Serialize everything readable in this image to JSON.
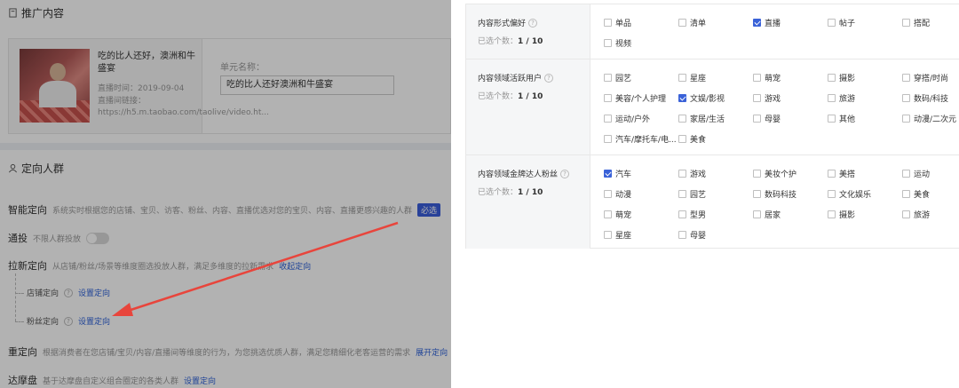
{
  "left": {
    "promo_title": "推广内容",
    "video": {
      "title": "吃的比人还好，澳洲和牛盛宴",
      "time": "直播时间：2019-09-04",
      "link": "直播间链接：https://h5.m.taobao.com/taolive/video.ht..."
    },
    "unit_label": "单元名称：",
    "unit_value": "吃的比人还好澳洲和牛盛宴",
    "target_title": "定向人群",
    "smart": {
      "name": "智能定向",
      "desc": "系统实时根据您的店铺、宝贝、访客、粉丝、内容、直播优选对您的宝贝、内容、直播更感兴趣的人群",
      "badge": "必选"
    },
    "tongtou": {
      "name": "通投",
      "desc": "不限人群投放"
    },
    "lax": {
      "name": "拉新定向",
      "desc": "从店铺/粉丝/场景等维度圈选投放人群，满足多维度的拉新需求",
      "link": "收起定向"
    },
    "shop": {
      "name": "店铺定向",
      "link": "设置定向"
    },
    "fans": {
      "name": "粉丝定向",
      "link": "设置定向"
    },
    "re": {
      "name": "重定向",
      "desc": "根据消费者在您店铺/宝贝/内容/直播间等维度的行为，为您挑选优质人群，满足您精细化老客运营的需求",
      "link": "展开定向"
    },
    "dmp": {
      "name": "达摩盘",
      "desc": "基于达摩盘自定义组合圈定的各类人群",
      "link": "设置定向"
    }
  },
  "panel": {
    "groups": [
      {
        "name": "内容形式偏好",
        "count_prefix": "已选个数：",
        "count": "1 / 10",
        "options": [
          {
            "label": "单品",
            "checked": false
          },
          {
            "label": "清单",
            "checked": false
          },
          {
            "label": "直播",
            "checked": true
          },
          {
            "label": "帖子",
            "checked": false
          },
          {
            "label": "搭配",
            "checked": false
          },
          {
            "label": "视频",
            "checked": false
          }
        ]
      },
      {
        "name": "内容领域活跃用户",
        "count_prefix": "已选个数：",
        "count": "1 / 10",
        "options": [
          {
            "label": "园艺",
            "checked": false
          },
          {
            "label": "星座",
            "checked": false
          },
          {
            "label": "萌宠",
            "checked": false
          },
          {
            "label": "摄影",
            "checked": false
          },
          {
            "label": "穿搭/时尚",
            "checked": false
          },
          {
            "label": "美容/个人护理",
            "checked": false
          },
          {
            "label": "文娱/影视",
            "checked": true
          },
          {
            "label": "游戏",
            "checked": false
          },
          {
            "label": "旅游",
            "checked": false
          },
          {
            "label": "数码/科技",
            "checked": false
          },
          {
            "label": "运动/户外",
            "checked": false
          },
          {
            "label": "家居/生活",
            "checked": false
          },
          {
            "label": "母婴",
            "checked": false
          },
          {
            "label": "其他",
            "checked": false
          },
          {
            "label": "动漫/二次元",
            "checked": false
          },
          {
            "label": "汽车/摩托车/电...",
            "checked": false
          },
          {
            "label": "美食",
            "checked": false
          }
        ]
      },
      {
        "name": "内容领域金牌达人粉丝",
        "count_prefix": "已选个数：",
        "count": "1 / 10",
        "options": [
          {
            "label": "汽车",
            "checked": true
          },
          {
            "label": "游戏",
            "checked": false
          },
          {
            "label": "美妆个护",
            "checked": false
          },
          {
            "label": "美搭",
            "checked": false
          },
          {
            "label": "运动",
            "checked": false
          },
          {
            "label": "动漫",
            "checked": false
          },
          {
            "label": "园艺",
            "checked": false
          },
          {
            "label": "数码科技",
            "checked": false
          },
          {
            "label": "文化娱乐",
            "checked": false
          },
          {
            "label": "美食",
            "checked": false
          },
          {
            "label": "萌宠",
            "checked": false
          },
          {
            "label": "型男",
            "checked": false
          },
          {
            "label": "居家",
            "checked": false
          },
          {
            "label": "摄影",
            "checked": false
          },
          {
            "label": "旅游",
            "checked": false
          },
          {
            "label": "星座",
            "checked": false
          },
          {
            "label": "母婴",
            "checked": false
          }
        ]
      }
    ]
  },
  "colors": {
    "accent": "#3a62d8",
    "arrow": "#e8453c",
    "link": "#2f62d9"
  }
}
